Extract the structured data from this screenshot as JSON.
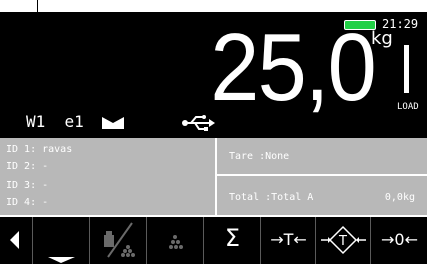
{
  "status": {
    "time": "21:29",
    "battery_color": "#22d046"
  },
  "weight": {
    "value": "25,0",
    "unit": "kg",
    "load_label": "LOAD",
    "scale_id": "W1  e1"
  },
  "icons": {
    "zero_indicator": "bowtie-icon",
    "usb": "usb-icon"
  },
  "ids": [
    "ID 1: ravas",
    "ID 2: -",
    "ID 3: -",
    "ID 4: -"
  ],
  "tare": "Tare  :None",
  "total": {
    "label": "Total :Total A",
    "value": "0,0kg"
  },
  "softkeys": [
    {
      "icon": "arrow-left-icon"
    },
    {
      "icon": "underscore-icon"
    },
    {
      "icon": "count-disabled-icon"
    },
    {
      "icon": "dots-disabled-icon"
    },
    {
      "label": "Σ",
      "icon": "sum-icon"
    },
    {
      "label": "→T←",
      "icon": "tare-icon"
    },
    {
      "icon": "preset-tare-icon"
    },
    {
      "label": "→0←",
      "icon": "zero-icon"
    }
  ]
}
